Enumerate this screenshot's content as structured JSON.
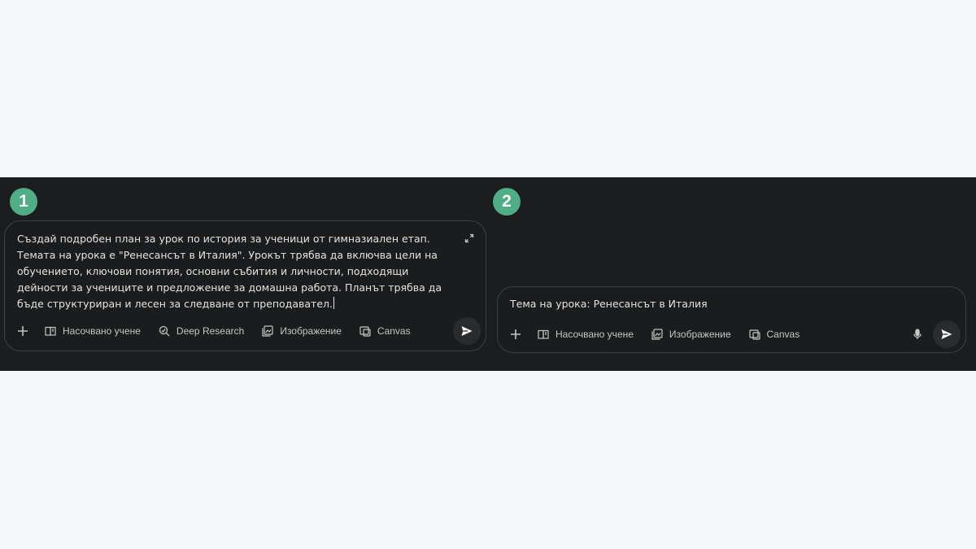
{
  "panels": [
    {
      "step": "1",
      "prompt": "Създай подробен план за урок по история за ученици от гимназиален етап. Темата на урока е \"Ренесансът в Италия\". Урокът трябва да включва цели на обучението, ключови понятия, основни събития и личности, подходящи дейности за учениците и предложение за домашна работа. Планът трябва да бъде структуриран и лесен за следване от преподавател.",
      "tools": {
        "guided_learning": "Насочвано учене",
        "deep_research": "Deep Research",
        "image": "Изображение",
        "canvas": "Canvas"
      }
    },
    {
      "step": "2",
      "prompt": "Тема на урока: Ренесансът в Италия",
      "tools": {
        "guided_learning": "Насочвано учене",
        "image": "Изображение",
        "canvas": "Canvas"
      }
    }
  ],
  "colors": {
    "badge": "#4fae85",
    "band_background": "#1c1d1e",
    "page_background": "#f5f8fb"
  },
  "icons": [
    "plus-icon",
    "book-icon",
    "deep-research-icon",
    "image-icon",
    "canvas-icon",
    "send-icon",
    "mic-icon",
    "expand-icon"
  ]
}
